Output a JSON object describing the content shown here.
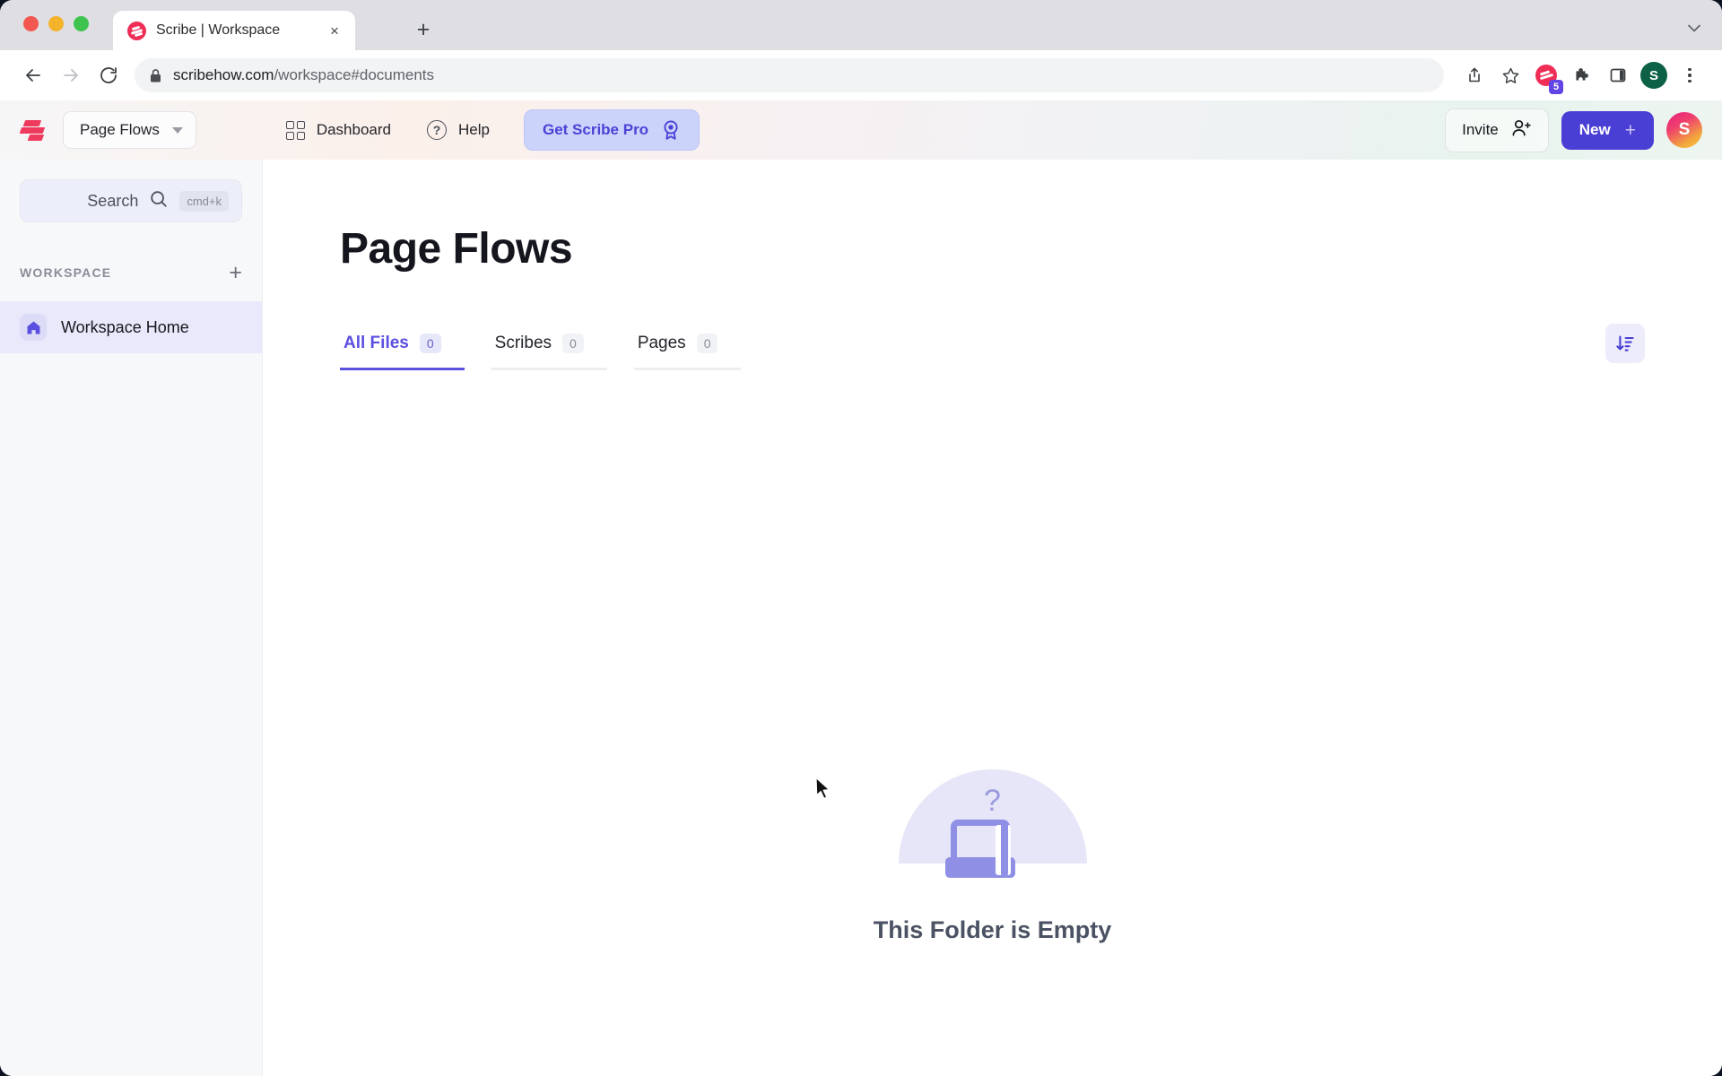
{
  "browser": {
    "tab": {
      "title": "Scribe | Workspace",
      "favicon": "scribe-logo-icon",
      "close": "×"
    },
    "new_tab_label": "+",
    "window_menu_icon": "chevron-down-icon",
    "nav": {
      "back": "back-icon",
      "forward": "forward-icon",
      "reload": "reload-icon"
    },
    "omnibox": {
      "lock": "lock-icon",
      "url_domain": "scribehow.com",
      "url_path": "/workspace#documents"
    },
    "toolbar_icons": {
      "share": "share-icon",
      "bookmark": "star-icon",
      "extension_scribe": "scribe-extension-icon",
      "extension_badge": "5",
      "puzzle": "puzzle-icon",
      "sidepanel": "side-panel-icon",
      "profile_initial": "S",
      "menu": "kebab-menu-icon"
    }
  },
  "app_header": {
    "logo": "scribe-logo-icon",
    "workspace_switcher": {
      "label": "Page Flows",
      "caret": "chevron-down-icon"
    },
    "nav": [
      {
        "label": "Dashboard",
        "icon": "dashboard-grid-icon"
      },
      {
        "label": "Help",
        "icon": "question-circle-icon"
      }
    ],
    "pro_button": {
      "label": "Get Scribe Pro",
      "icon": "medal-icon",
      "color": "#4b42d6",
      "bg": "#ccd3fb"
    },
    "invite_button": {
      "label": "Invite",
      "icon": "user-plus-icon"
    },
    "new_button": {
      "label": "New",
      "icon": "plus-icon",
      "bg": "#4a3fd4"
    },
    "avatar": {
      "initial": "S"
    }
  },
  "sidebar": {
    "search": {
      "label": "Search",
      "icon": "search-icon",
      "shortcut": "cmd+k"
    },
    "section": {
      "title": "WORKSPACE",
      "add_icon": "plus-icon"
    },
    "items": [
      {
        "label": "Workspace Home",
        "icon": "home-icon",
        "active": true
      }
    ]
  },
  "content": {
    "title": "Page Flows",
    "tabs": [
      {
        "label": "All Files",
        "count": "0",
        "active": true
      },
      {
        "label": "Scribes",
        "count": "0",
        "active": false
      },
      {
        "label": "Pages",
        "count": "0",
        "active": false
      }
    ],
    "sort_button": {
      "icon": "sort-descending-icon"
    },
    "empty_state": {
      "text": "This Folder is Empty",
      "illustration": "empty-folder-question-icon",
      "accent": "#8f8fe6"
    }
  }
}
